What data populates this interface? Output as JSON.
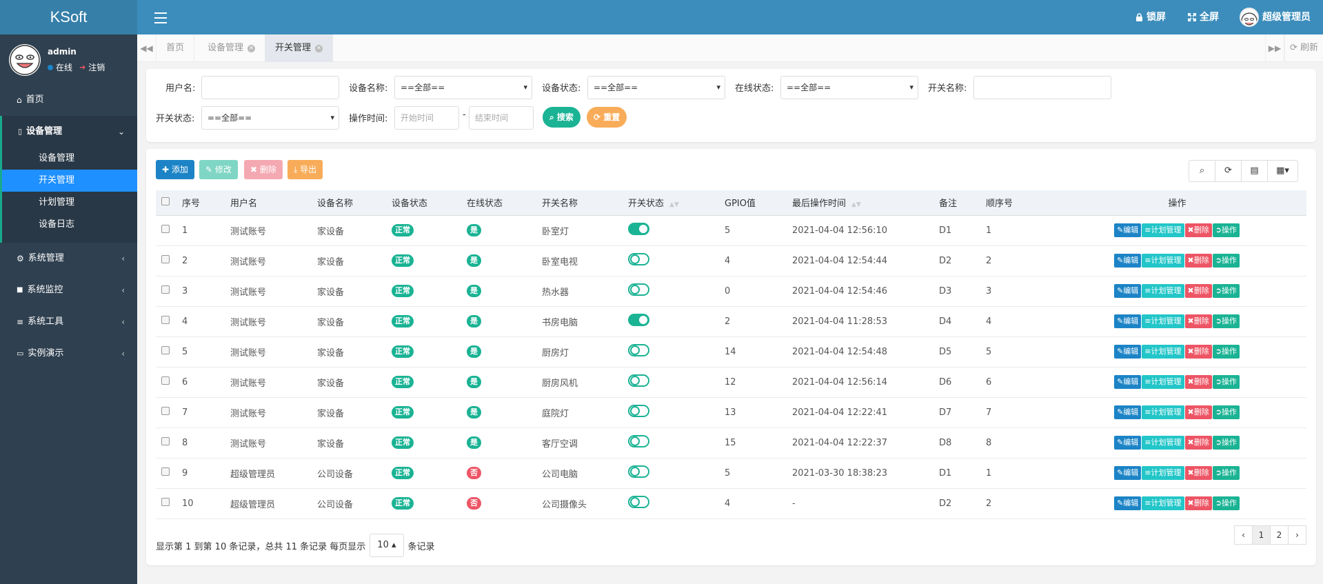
{
  "app": {
    "logo": "KSoft"
  },
  "topbar": {
    "lock_label": "锁屏",
    "fullscreen_label": "全屏",
    "user_label": "超级管理员"
  },
  "sidebar": {
    "user": {
      "name": "admin",
      "status": "在线",
      "logout": "注销"
    },
    "items": [
      {
        "label": "首页",
        "icon": "home-icon"
      },
      {
        "label": "设备管理",
        "icon": "device-icon",
        "expanded": true,
        "children": [
          "设备管理",
          "开关管理",
          "计划管理",
          "设备日志"
        ],
        "active_child": "开关管理"
      },
      {
        "label": "系统管理",
        "icon": "gear-icon"
      },
      {
        "label": "系统监控",
        "icon": "video-icon"
      },
      {
        "label": "系统工具",
        "icon": "list-icon"
      },
      {
        "label": "实例演示",
        "icon": "desktop-icon"
      }
    ]
  },
  "tabs": {
    "items": [
      "首页",
      "设备管理",
      "开关管理"
    ],
    "active": "开关管理",
    "refresh_label": "刷新"
  },
  "search": {
    "username_label": "用户名:",
    "device_name_label": "设备名称:",
    "device_name_value": "==全部==",
    "device_status_label": "设备状态:",
    "device_status_value": "==全部==",
    "online_status_label": "在线状态:",
    "online_status_value": "==全部==",
    "switch_name_label": "开关名称:",
    "switch_status_label": "开关状态:",
    "switch_status_value": "==全部==",
    "op_time_label": "操作时间:",
    "start_placeholder": "开始时间",
    "end_placeholder": "结束时间",
    "range_sep": "-",
    "search_btn": "搜索",
    "reset_btn": "重置"
  },
  "toolbar": {
    "add": "添加",
    "edit": "修改",
    "delete": "删除",
    "export": "导出"
  },
  "table": {
    "columns": [
      "序号",
      "用户名",
      "设备名称",
      "设备状态",
      "在线状态",
      "开关名称",
      "开关状态",
      "GPIO值",
      "最后操作时间",
      "备注",
      "顺序号",
      "操作"
    ],
    "rows": [
      {
        "no": "1",
        "user": "测试账号",
        "device": "家设备",
        "status": "正常",
        "online": "是",
        "switch": "卧室灯",
        "on": true,
        "gpio": "5",
        "time": "2021-04-04 12:56:10",
        "remark": "D1",
        "order": "1"
      },
      {
        "no": "2",
        "user": "测试账号",
        "device": "家设备",
        "status": "正常",
        "online": "是",
        "switch": "卧室电视",
        "on": false,
        "gpio": "4",
        "time": "2021-04-04 12:54:44",
        "remark": "D2",
        "order": "2"
      },
      {
        "no": "3",
        "user": "测试账号",
        "device": "家设备",
        "status": "正常",
        "online": "是",
        "switch": "热水器",
        "on": false,
        "gpio": "0",
        "time": "2021-04-04 12:54:46",
        "remark": "D3",
        "order": "3"
      },
      {
        "no": "4",
        "user": "测试账号",
        "device": "家设备",
        "status": "正常",
        "online": "是",
        "switch": "书房电脑",
        "on": true,
        "gpio": "2",
        "time": "2021-04-04 11:28:53",
        "remark": "D4",
        "order": "4"
      },
      {
        "no": "5",
        "user": "测试账号",
        "device": "家设备",
        "status": "正常",
        "online": "是",
        "switch": "厨房灯",
        "on": false,
        "gpio": "14",
        "time": "2021-04-04 12:54:48",
        "remark": "D5",
        "order": "5"
      },
      {
        "no": "6",
        "user": "测试账号",
        "device": "家设备",
        "status": "正常",
        "online": "是",
        "switch": "厨房风机",
        "on": false,
        "gpio": "12",
        "time": "2021-04-04 12:56:14",
        "remark": "D6",
        "order": "6"
      },
      {
        "no": "7",
        "user": "测试账号",
        "device": "家设备",
        "status": "正常",
        "online": "是",
        "switch": "庭院灯",
        "on": false,
        "gpio": "13",
        "time": "2021-04-04 12:22:41",
        "remark": "D7",
        "order": "7"
      },
      {
        "no": "8",
        "user": "测试账号",
        "device": "家设备",
        "status": "正常",
        "online": "是",
        "switch": "客厅空调",
        "on": false,
        "gpio": "15",
        "time": "2021-04-04 12:22:37",
        "remark": "D8",
        "order": "8"
      },
      {
        "no": "9",
        "user": "超级管理员",
        "device": "公司设备",
        "status": "正常",
        "online": "否",
        "switch": "公司电脑",
        "on": false,
        "gpio": "5",
        "time": "2021-03-30 18:38:23",
        "remark": "D1",
        "order": "1"
      },
      {
        "no": "10",
        "user": "超级管理员",
        "device": "公司设备",
        "status": "正常",
        "online": "否",
        "switch": "公司摄像头",
        "on": false,
        "gpio": "4",
        "time": "-",
        "remark": "D2",
        "order": "2"
      }
    ],
    "actions": [
      "编辑",
      "计划管理",
      "删除",
      "操作"
    ]
  },
  "footer": {
    "info_prefix": "显示第 1 到第 10 条记录，总共 11 条记录  每页显示",
    "page_size": "10",
    "info_suffix": "条记录",
    "pages": [
      "‹",
      "1",
      "2",
      "›"
    ],
    "current_page": "1"
  },
  "colors": {
    "topbar": "#3c8dbc",
    "sidebar": "#2f4050",
    "primary": "#1ab394",
    "blue": "#1c84c6",
    "red": "#ed5565",
    "orange": "#f8ac59",
    "active_sub": "#1e90ff"
  }
}
